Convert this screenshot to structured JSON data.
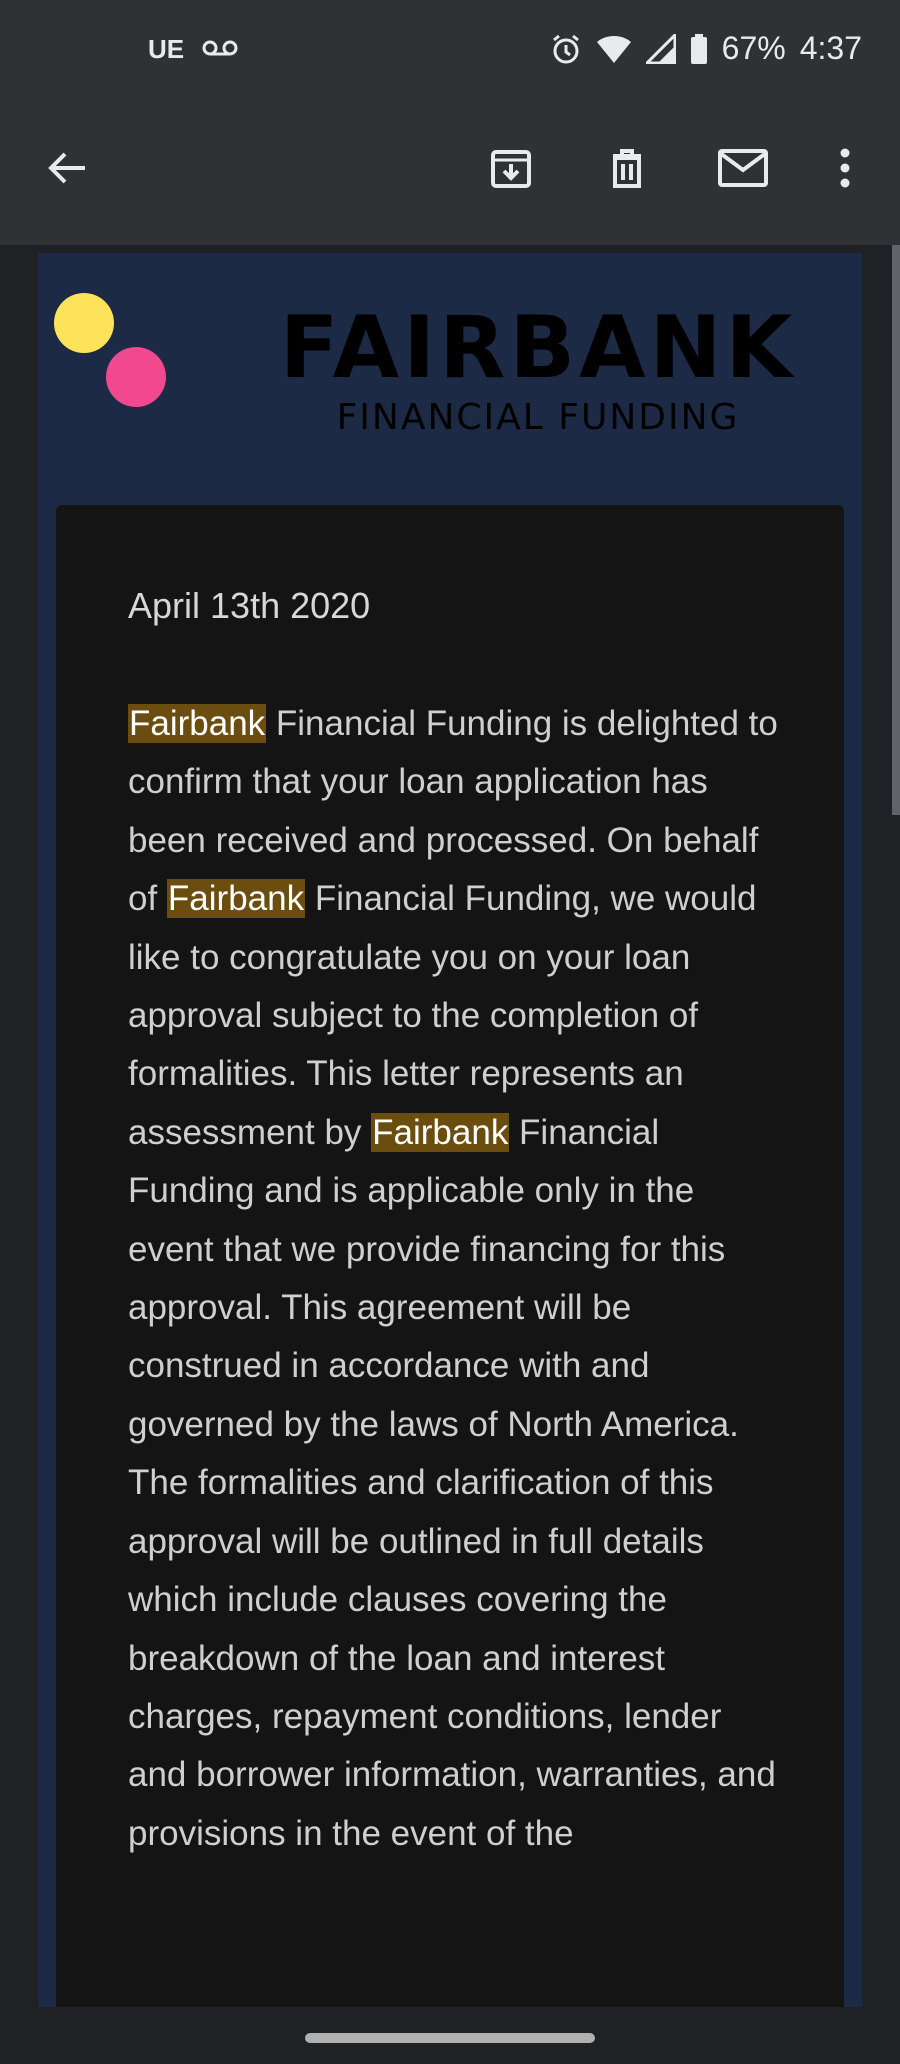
{
  "status_bar": {
    "carrier": "UE",
    "voicemail_icon": "voicemail-icon",
    "battery": "67%",
    "time": "4:37",
    "icons": [
      "alarm-icon",
      "wifi-icon",
      "signal-icon",
      "battery-icon"
    ]
  },
  "toolbar": {
    "back_icon": "arrow-left-icon",
    "archive_icon": "archive-icon",
    "delete_icon": "trash-icon",
    "mark_unread_icon": "mail-icon",
    "more_icon": "more-vertical-icon"
  },
  "email": {
    "brand_title": "FAIRBANK",
    "brand_subtitle": "FINANCIAL FUNDING",
    "date": "April 13th 2020",
    "paragraph": [
      {
        "text": "Fairbank",
        "highlight": true
      },
      {
        "text": " Financial Funding is delighted to confirm that your loan application has been received and processed. On behalf of ",
        "highlight": false
      },
      {
        "text": "Fairbank",
        "highlight": true
      },
      {
        "text": " Financial Funding, we would like to congratulate you on your loan approval subject to the completion of formalities. This letter represents an assessment by ",
        "highlight": false
      },
      {
        "text": "Fairbank",
        "highlight": true
      },
      {
        "text": " Financial Funding and is applicable only in the event that we provide financing for this approval. This agreement will be construed in accordance with and governed by the laws of North America. The formalities and clarification of this approval will be outlined in full details which include clauses covering the breakdown of the loan and interest charges, repayment conditions, lender and borrower information, warranties, and provisions in the event of the",
        "highlight": false
      }
    ]
  },
  "colors": {
    "highlight_bg": "#6b4e0f",
    "dot_yellow": "#fde35a",
    "dot_pink": "#f0498f",
    "header_bg": "#1d2a45"
  }
}
